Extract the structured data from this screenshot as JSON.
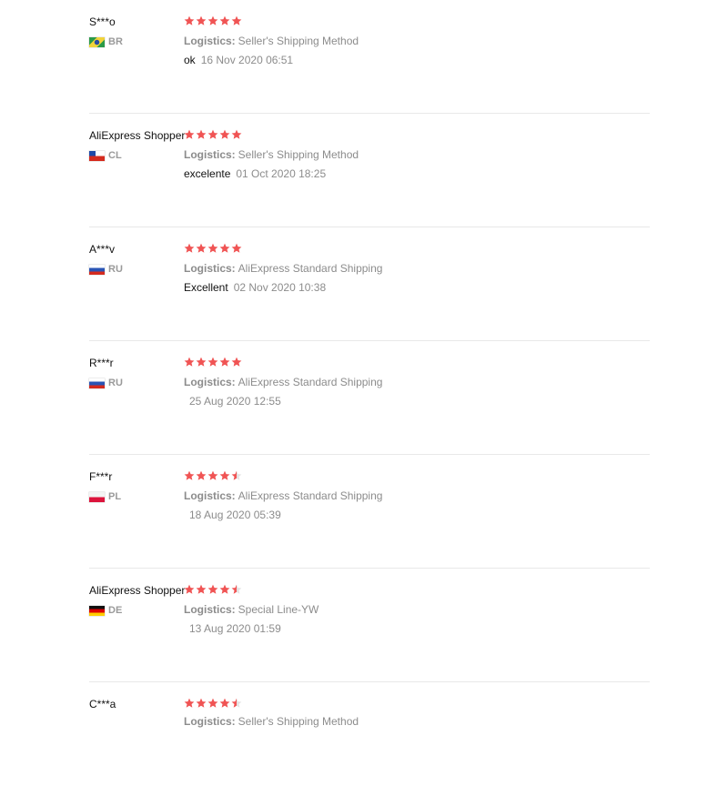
{
  "logistics_label": "Logistics:",
  "colors": {
    "star": "#f05454",
    "muted_text": "#8c8c8c",
    "primary_text": "#111111",
    "divider": "#e8e8e8"
  },
  "reviews": [
    {
      "name": "S***o",
      "country": "BR",
      "flag_icon": "brazil-flag-icon",
      "rating": 5,
      "shipping": "Seller's Shipping Method",
      "comment": "ok",
      "date": "16 Nov 2020 06:51"
    },
    {
      "name": "AliExpress Shopper",
      "country": "CL",
      "flag_icon": "chile-flag-icon",
      "rating": 5,
      "shipping": "Seller's Shipping Method",
      "comment": "excelente",
      "date": "01 Oct 2020 18:25"
    },
    {
      "name": "A***v",
      "country": "RU",
      "flag_icon": "russia-flag-icon",
      "rating": 5,
      "shipping": "AliExpress Standard Shipping",
      "comment": "Excellent",
      "date": "02 Nov 2020 10:38"
    },
    {
      "name": "R***r",
      "country": "RU",
      "flag_icon": "russia-flag-icon",
      "rating": 5,
      "shipping": "AliExpress Standard Shipping",
      "comment": "",
      "date": "25 Aug 2020 12:55"
    },
    {
      "name": "F***r",
      "country": "PL",
      "flag_icon": "poland-flag-icon",
      "rating": 4.5,
      "shipping": "AliExpress Standard Shipping",
      "comment": "",
      "date": "18 Aug 2020 05:39"
    },
    {
      "name": "AliExpress Shopper",
      "country": "DE",
      "flag_icon": "germany-flag-icon",
      "rating": 4.5,
      "shipping": "Special Line-YW",
      "comment": "",
      "date": "13 Aug 2020 01:59"
    },
    {
      "name": "C***a",
      "country": "",
      "flag_icon": "",
      "rating": 4.5,
      "shipping": "Seller's Shipping Method",
      "comment": "",
      "date": ""
    }
  ]
}
